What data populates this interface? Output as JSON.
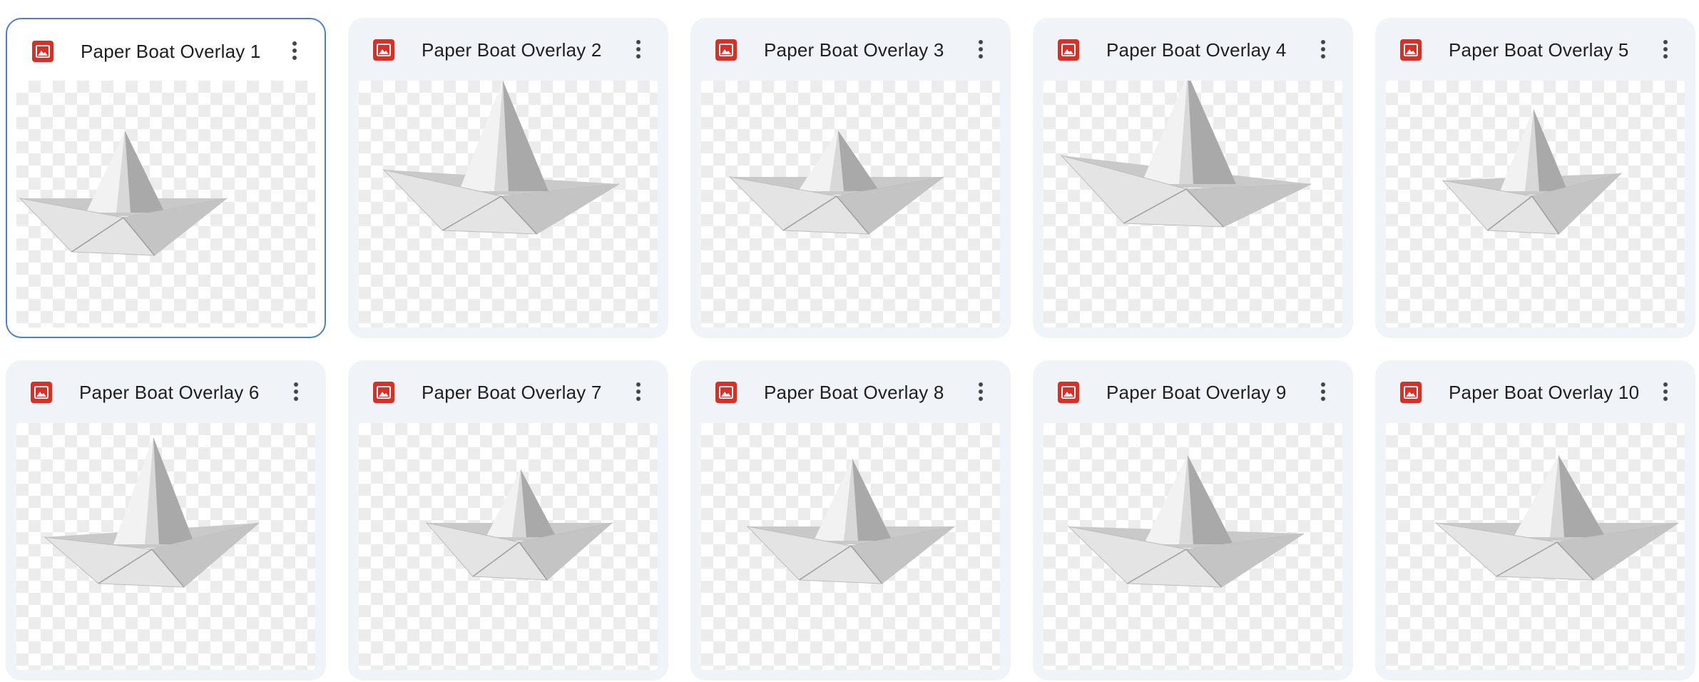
{
  "files": [
    {
      "name": "Paper Boat Overlay 1",
      "type_icon": "image-file-icon",
      "selected": true
    },
    {
      "name": "Paper Boat Overlay 2",
      "type_icon": "image-file-icon",
      "selected": false
    },
    {
      "name": "Paper Boat Overlay 3",
      "type_icon": "image-file-icon",
      "selected": false
    },
    {
      "name": "Paper Boat Overlay 4",
      "type_icon": "image-file-icon",
      "selected": false
    },
    {
      "name": "Paper Boat Overlay 5",
      "type_icon": "image-file-icon",
      "selected": false
    },
    {
      "name": "Paper Boat Overlay 6",
      "type_icon": "image-file-icon",
      "selected": false
    },
    {
      "name": "Paper Boat Overlay 7",
      "type_icon": "image-file-icon",
      "selected": false
    },
    {
      "name": "Paper Boat Overlay 8",
      "type_icon": "image-file-icon",
      "selected": false
    },
    {
      "name": "Paper Boat Overlay 9",
      "type_icon": "image-file-icon",
      "selected": false
    },
    {
      "name": "Paper Boat Overlay 10",
      "type_icon": "image-file-icon",
      "selected": false
    }
  ],
  "colors": {
    "image_icon": "#d93025",
    "card_background": "#f0f4f9",
    "selected_border": "#4a7fd6",
    "text": "#1f1f1f"
  }
}
